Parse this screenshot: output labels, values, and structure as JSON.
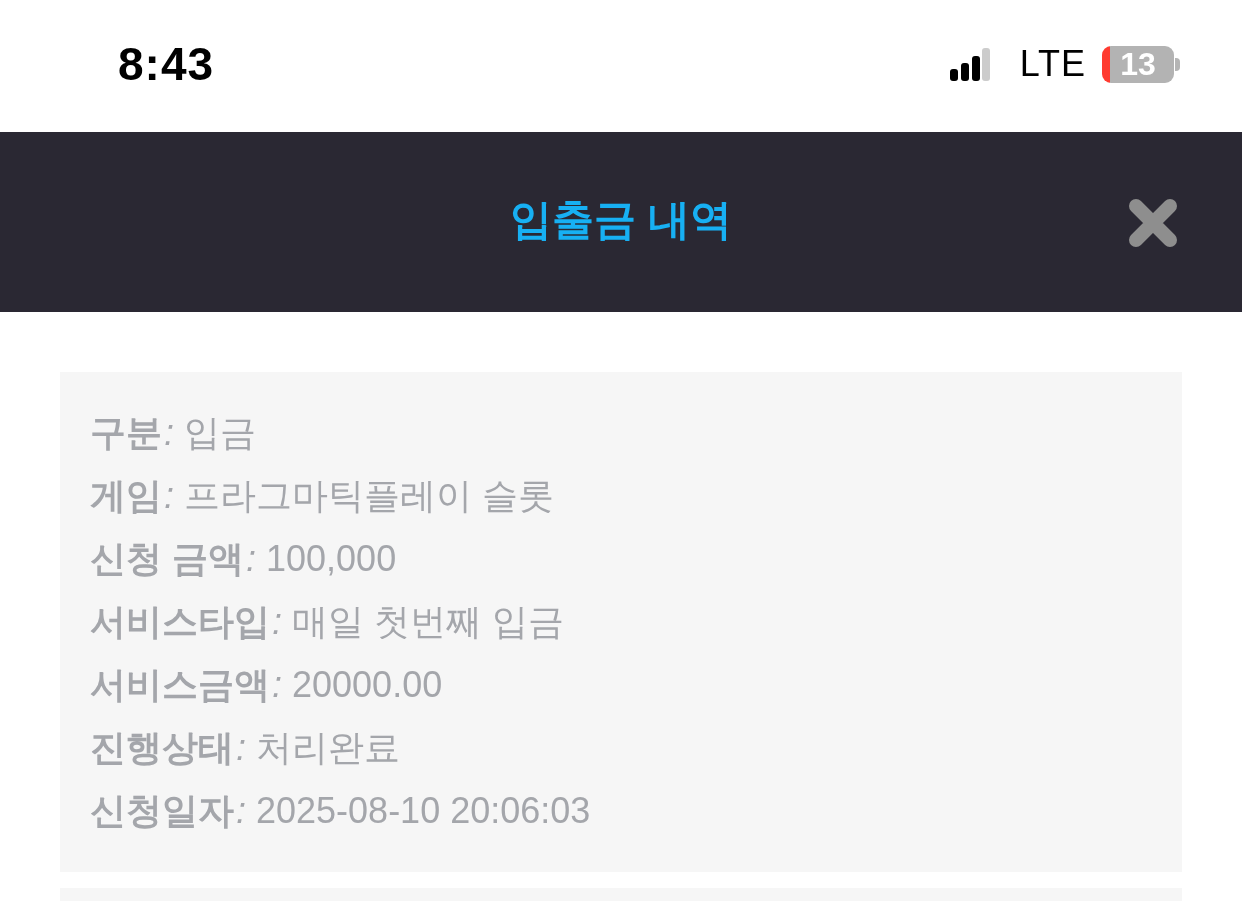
{
  "status_bar": {
    "time": "8:43",
    "network": "LTE",
    "battery": "13"
  },
  "header": {
    "title": "입출금 내역"
  },
  "records": [
    {
      "fields": [
        {
          "label": "구분",
          "separator": ":",
          "value": "입금"
        },
        {
          "label": "게임",
          "separator": ":",
          "value": "프라그마틱플레이 슬롯"
        },
        {
          "label": "신청 금액",
          "separator": ":",
          "value": "100,000"
        },
        {
          "label": "서비스타입",
          "separator": ":",
          "value": "매일 첫번째 입금"
        },
        {
          "label": "서비스금액",
          "separator": ":",
          "value": "20000.00"
        },
        {
          "label": "진행상태",
          "separator": ":",
          "value": "처리완료"
        },
        {
          "label": "신청일자",
          "separator": ":",
          "value": "2025-08-10 20:06:03"
        }
      ]
    },
    {
      "cut_off": true
    }
  ]
}
